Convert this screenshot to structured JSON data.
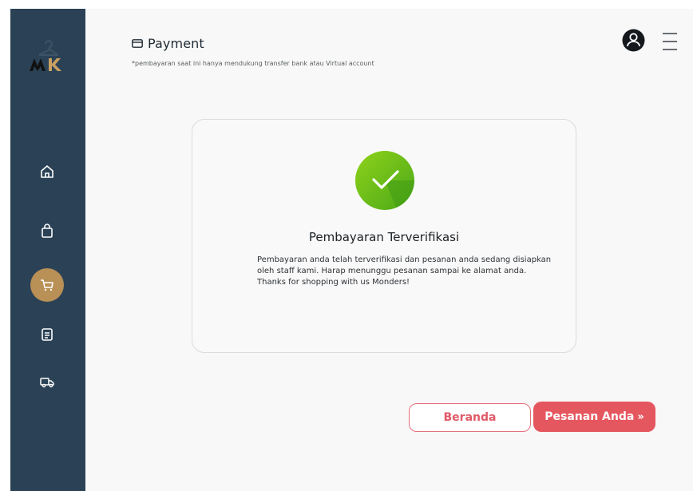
{
  "sidebar": {
    "logo_text": "MK",
    "items": [
      {
        "icon": "home-icon",
        "active": false
      },
      {
        "icon": "shopping-bag-icon",
        "active": false
      },
      {
        "icon": "cart-icon",
        "active": true
      },
      {
        "icon": "document-icon",
        "active": false
      },
      {
        "icon": "delivery-truck-icon",
        "active": false
      }
    ],
    "active_color": "#b99056",
    "background_color": "#2b4256"
  },
  "header": {
    "title": "Payment",
    "title_icon": "credit-card-icon",
    "note": "*pembayaran saat ini hanya mendukung transfer bank atau Virtual account",
    "avatar_icon": "user-avatar-icon",
    "menu_icon": "hamburger-menu-icon"
  },
  "card": {
    "status_icon": "check-circle-icon",
    "title": "Pembayaran Terverifikasi",
    "message": "Pembayaran anda telah terverifikasi dan pesanan anda sedang disiapkan oleh staff kami. Harap menunggu pesanan sampai ke alamat anda. Thanks for shopping with us Monders!"
  },
  "actions": {
    "home_label": "Beranda",
    "orders_label": "Pesanan Anda",
    "orders_suffix": "»",
    "accent_color": "#e5575f"
  }
}
